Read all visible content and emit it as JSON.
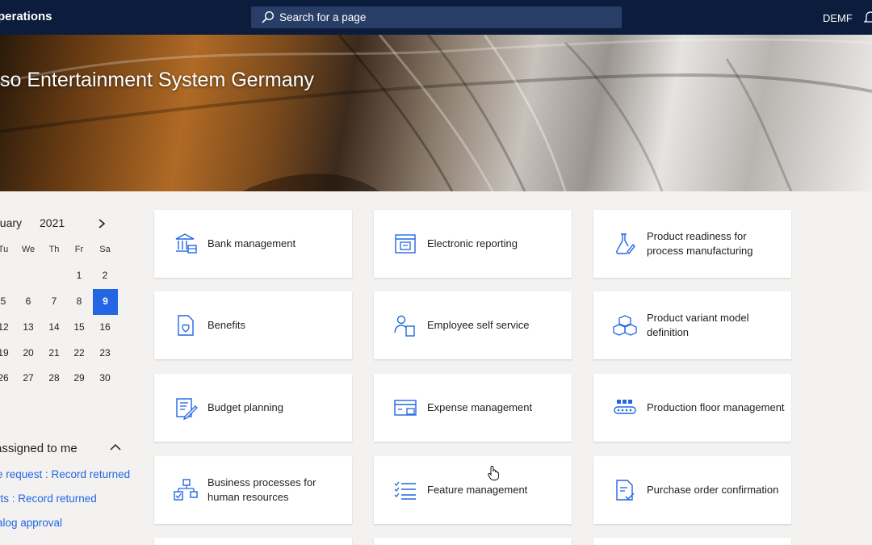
{
  "topbar": {
    "app_name": "perations",
    "search_placeholder": "Search for a page",
    "company": "DEMF"
  },
  "banner": {
    "title": "so Entertainment System Germany"
  },
  "calendar": {
    "month": "nuary",
    "year": "2021",
    "weekdays": [
      "Tu",
      "We",
      "Th",
      "Fr",
      "Sa"
    ],
    "weeks": [
      [
        "",
        "",
        "",
        "1",
        "2"
      ],
      [
        "5",
        "6",
        "7",
        "8",
        "9"
      ],
      [
        "12",
        "13",
        "14",
        "15",
        "16"
      ],
      [
        "19",
        "20",
        "21",
        "22",
        "23"
      ],
      [
        "26",
        "27",
        "28",
        "29",
        "30"
      ]
    ],
    "selected_day": "9"
  },
  "work_items": {
    "title": "assigned to me",
    "links": [
      "e request : Record returned",
      "rts : Record returned",
      "alog approval"
    ]
  },
  "tiles": [
    {
      "label": "Bank management",
      "icon": "bank-icon"
    },
    {
      "label": "Electronic reporting",
      "icon": "report-icon"
    },
    {
      "label": "Product readiness for process manufacturing",
      "icon": "flask-icon"
    },
    {
      "label": "Benefits",
      "icon": "heart-document-icon"
    },
    {
      "label": "Employee self service",
      "icon": "person-document-icon"
    },
    {
      "label": "Product variant model definition",
      "icon": "cubes-icon"
    },
    {
      "label": "Budget planning",
      "icon": "budget-pencil-icon"
    },
    {
      "label": "Expense management",
      "icon": "expense-card-icon"
    },
    {
      "label": "Production floor management",
      "icon": "conveyor-icon"
    },
    {
      "label": "Business processes for human resources",
      "icon": "process-flow-icon"
    },
    {
      "label": "Feature management",
      "icon": "checklist-icon"
    },
    {
      "label": "Purchase order confirmation",
      "icon": "document-check-icon"
    }
  ],
  "colors": {
    "topbar": "#0b1c3d",
    "search_bg": "#283e66",
    "accent": "#2266e3",
    "page_bg": "#f3f2f1",
    "tile_bg": "#ffffff"
  }
}
